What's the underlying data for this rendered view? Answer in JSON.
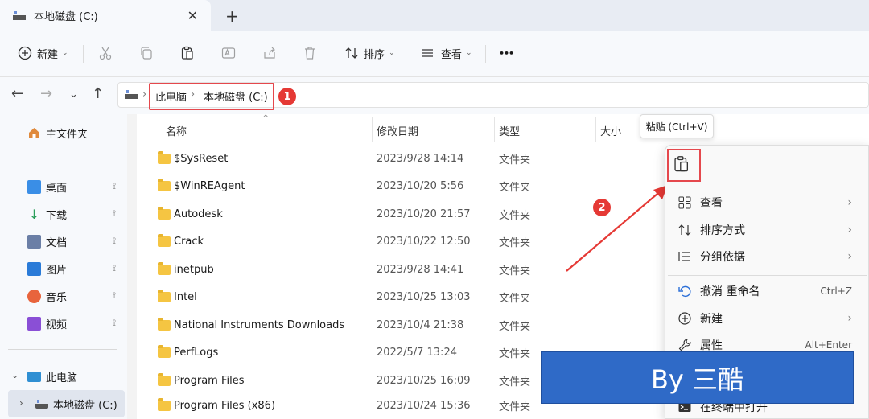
{
  "window": {
    "tab_title": "本地磁盘 (C:)",
    "close_glyph": "✕",
    "new_tab_glyph": "+"
  },
  "toolbar": {
    "new_label": "新建",
    "sort_label": "排序",
    "view_label": "查看",
    "more_glyph": "•••"
  },
  "address": {
    "crumbs": [
      "此电脑",
      "本地磁盘 (C:)"
    ],
    "badge1": "1"
  },
  "sidebar": {
    "home": "主文件夹",
    "quick": [
      {
        "label": "桌面",
        "color": "#3a8ee6"
      },
      {
        "label": "下载",
        "color": "#2b9e5b"
      },
      {
        "label": "文档",
        "color": "#6b7fa6"
      },
      {
        "label": "图片",
        "color": "#2a7bd8"
      },
      {
        "label": "音乐",
        "color": "#e8643c"
      },
      {
        "label": "视频",
        "color": "#8a4fd6"
      }
    ],
    "this_pc": "此电脑",
    "local_disk": "本地磁盘 (C:)",
    "pin_glyph": "📌"
  },
  "columns": {
    "name": "名称",
    "modified": "修改日期",
    "type": "类型",
    "size": "大小"
  },
  "files": [
    {
      "name": "$SysReset",
      "date": "2023/9/28 14:14",
      "type": "文件夹"
    },
    {
      "name": "$WinREAgent",
      "date": "2023/10/20 5:56",
      "type": "文件夹"
    },
    {
      "name": "Autodesk",
      "date": "2023/10/20 21:57",
      "type": "文件夹"
    },
    {
      "name": "Crack",
      "date": "2023/10/22 12:50",
      "type": "文件夹"
    },
    {
      "name": "inetpub",
      "date": "2023/9/28 14:41",
      "type": "文件夹"
    },
    {
      "name": "Intel",
      "date": "2023/10/25 13:03",
      "type": "文件夹"
    },
    {
      "name": "National Instruments Downloads",
      "date": "2023/10/4 21:38",
      "type": "文件夹"
    },
    {
      "name": "PerfLogs",
      "date": "2022/5/7 13:24",
      "type": "文件夹"
    },
    {
      "name": "Program Files",
      "date": "2023/10/25 16:09",
      "type": "文件夹"
    },
    {
      "name": "Program Files (x86)",
      "date": "2023/10/24 15:36",
      "type": "文件夹"
    }
  ],
  "context_menu": {
    "tooltip": "粘贴 (Ctrl+V)",
    "badge2": "2",
    "items": [
      {
        "label": "查看",
        "shortcut": "",
        "submenu": true
      },
      {
        "label": "排序方式",
        "shortcut": "",
        "submenu": true
      },
      {
        "label": "分组依据",
        "shortcut": "",
        "submenu": true
      },
      {
        "label": "撤消 重命名",
        "shortcut": "Ctrl+Z",
        "submenu": false
      },
      {
        "label": "新建",
        "shortcut": "",
        "submenu": true
      },
      {
        "label": "属性",
        "shortcut": "Alt+Enter",
        "submenu": false
      },
      {
        "label": "在终端中打开",
        "shortcut": "",
        "submenu": false
      }
    ]
  },
  "watermark": "By 三酷",
  "colors": {
    "accent_red": "#e53935",
    "banner_blue": "#2f6ac7",
    "folder": "#f5c542"
  }
}
